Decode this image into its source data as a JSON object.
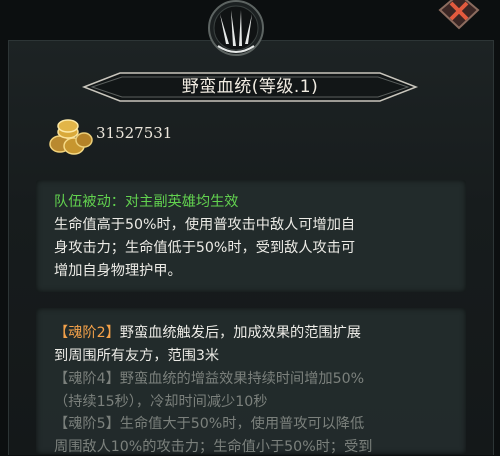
{
  "header": {
    "title": "野蛮血统(等级.1)"
  },
  "currency": {
    "amount": "31527531"
  },
  "team_passive": {
    "heading": "队伍被动：对主副英雄均生效",
    "lines": [
      "生命值高于50%时，使用普攻击中敌人可增加自",
      "身攻击力；生命值低于50%时，受到敌人攻击可",
      "增加自身物理护甲。"
    ]
  },
  "soul_tiers": [
    {
      "tag": "【魂阶2】",
      "lines": [
        "野蛮血统触发后，加成效果的范围扩展",
        "到周围所有友方，范围3米"
      ]
    },
    {
      "tag": "【魂阶4】",
      "lines": [
        "野蛮血统的增益效果持续时间增加50%",
        "（持续15秒），冷却时间减少10秒"
      ]
    },
    {
      "tag": "【魂阶5】",
      "lines": [
        "生命值大于50%时，使用普攻可以降低",
        "周围敌人10%的攻击力；生命值小于50%时；受到"
      ]
    }
  ],
  "colors": {
    "green": "#62d24f",
    "orange": "#f3a14a",
    "locked": "#7b807c",
    "text": "#ecebe6"
  },
  "icons": {
    "emblem": "claw-emblem-icon",
    "close": "close-x-icon",
    "coins": "gold-coins-icon"
  }
}
